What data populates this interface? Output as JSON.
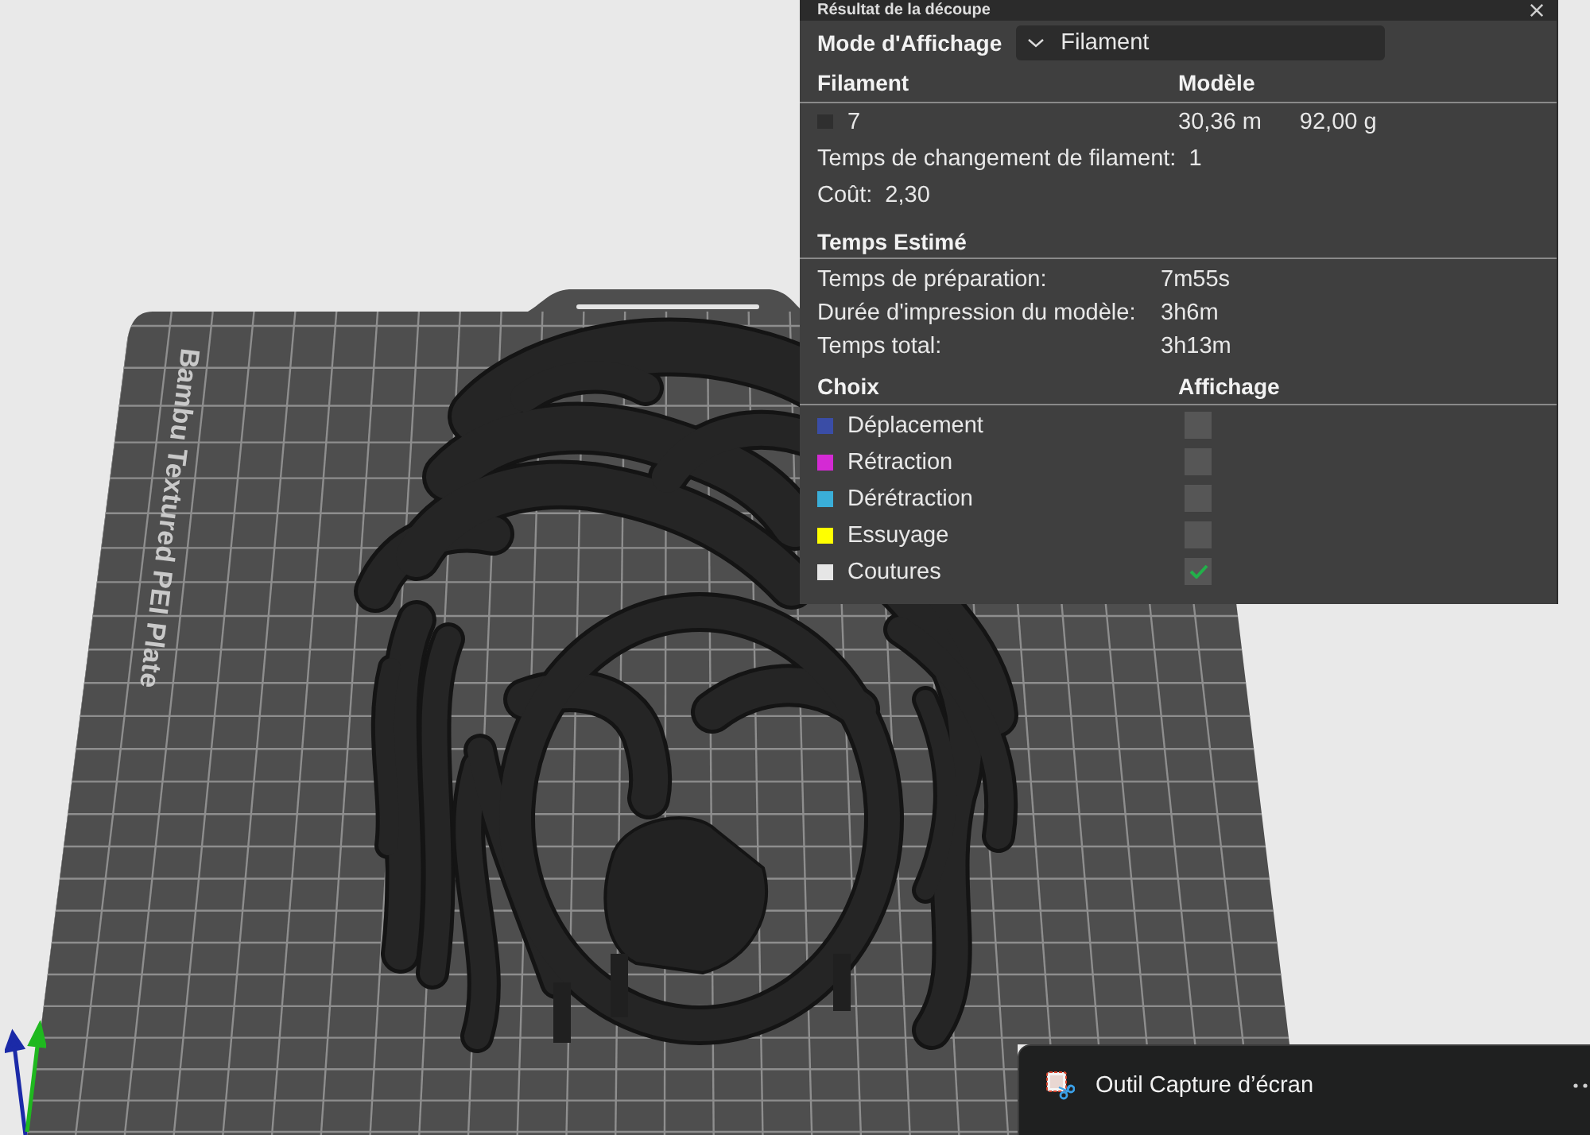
{
  "panel": {
    "title": "Résultat de la découpe",
    "display_mode": {
      "label": "Mode d'Affichage",
      "value": "Filament"
    },
    "filament_table": {
      "columns": [
        "Filament",
        "Modèle"
      ],
      "rows": [
        {
          "color": "#2f2f2f",
          "filament": "7",
          "length": "30,36 m",
          "weight": "92,00 g"
        }
      ]
    },
    "stats": [
      {
        "label": "Temps de changement de filament:",
        "value": "1"
      },
      {
        "label": "Coût:",
        "value": "2,30"
      }
    ],
    "estimated_time": {
      "title": "Temps Estimé",
      "rows": [
        {
          "label": "Temps de préparation:",
          "value": "7m55s"
        },
        {
          "label": "Durée d'impression du modèle:",
          "value": "3h6m"
        },
        {
          "label": "Temps total:",
          "value": "3h13m"
        }
      ]
    },
    "options": {
      "columns": [
        "Choix",
        "Affichage"
      ],
      "items": [
        {
          "label": "Déplacement",
          "color": "#3a4da6",
          "checked": false
        },
        {
          "label": "Rétraction",
          "color": "#d42ad4",
          "checked": false
        },
        {
          "label": "Dérétraction",
          "color": "#3aaed8",
          "checked": false
        },
        {
          "label": "Essuyage",
          "color": "#ffff00",
          "checked": false
        },
        {
          "label": "Coutures",
          "color": "#e6e6e6",
          "checked": true
        }
      ]
    }
  },
  "plate": {
    "label": "Bambu Textured PEI Plate"
  },
  "notification": {
    "app": "Outil Capture d’écran"
  }
}
